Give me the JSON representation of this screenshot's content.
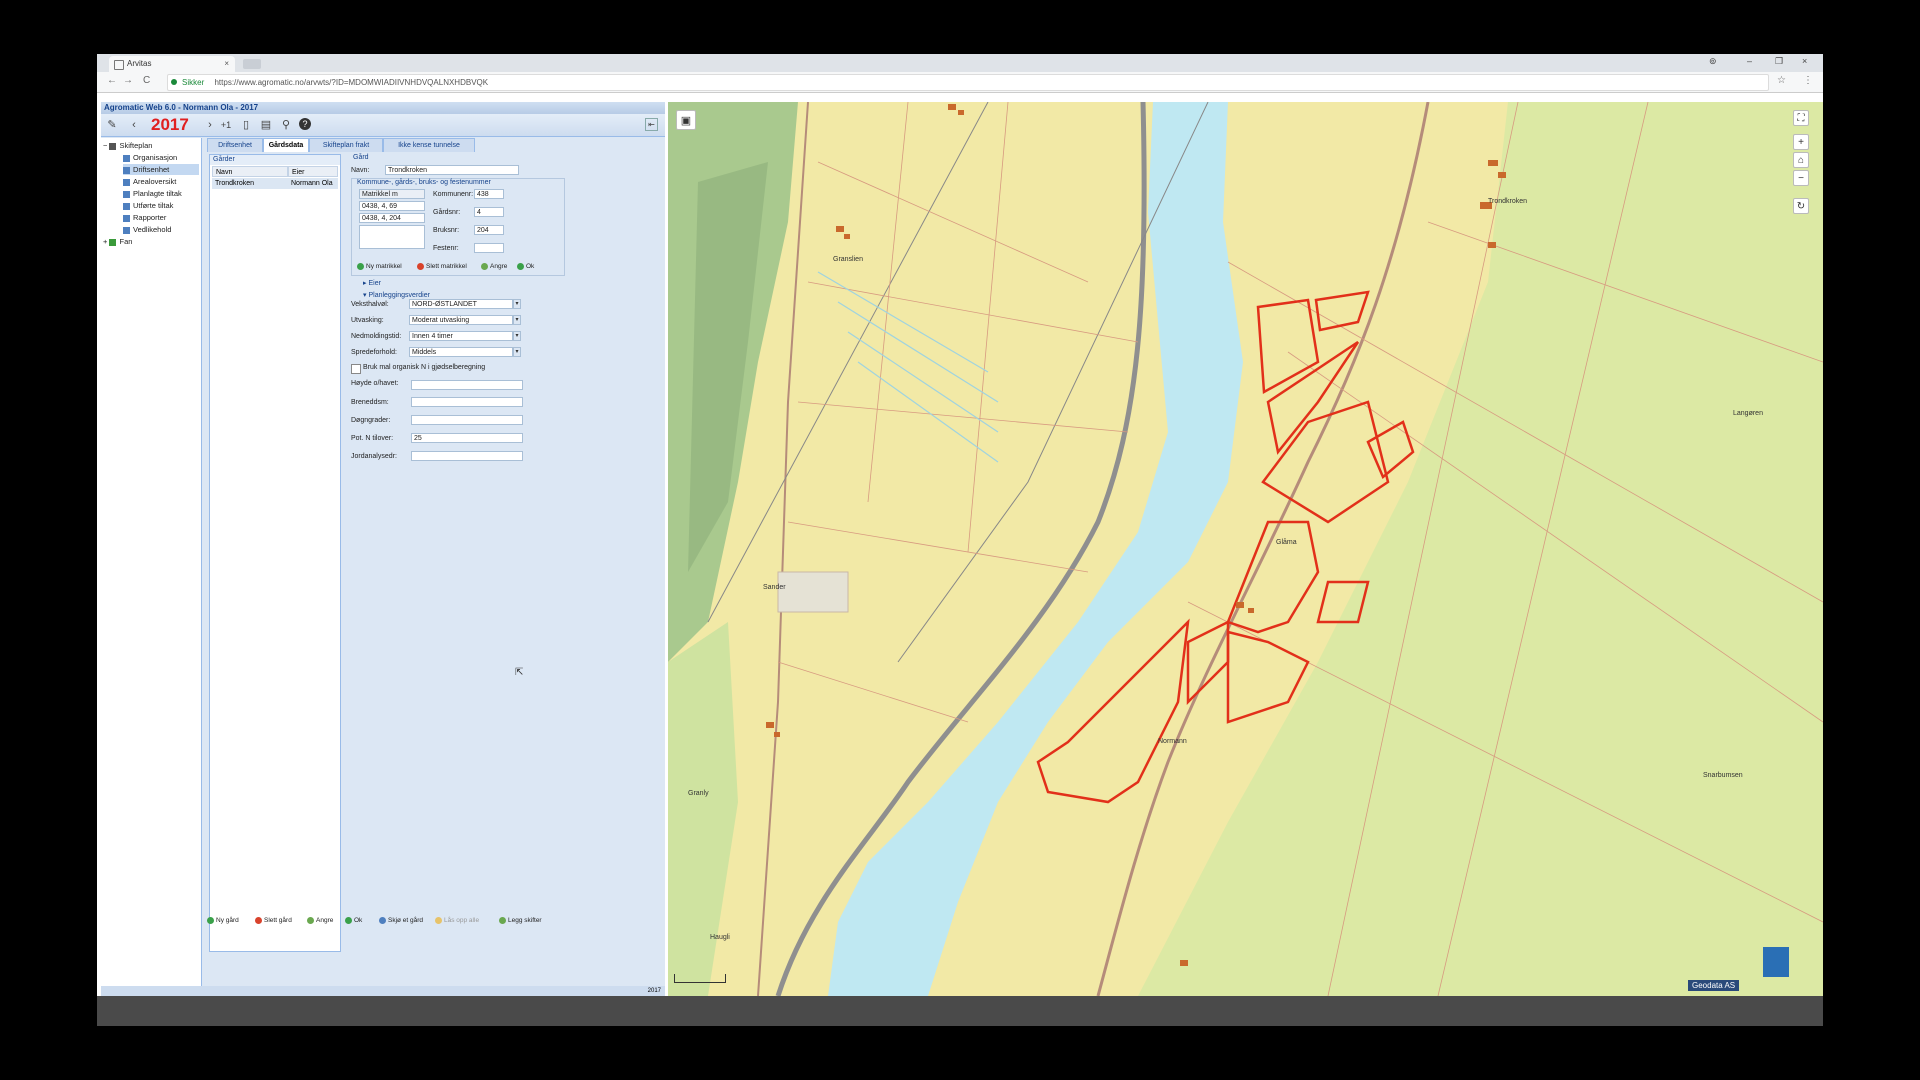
{
  "browser": {
    "tab_title": "Arvitas",
    "tab_close": "×",
    "window_controls": [
      "⊚",
      "–",
      "❐",
      "×"
    ],
    "nav": [
      "←",
      "→",
      "C"
    ],
    "secure_label": "Sikker",
    "url": "https://www.agromatic.no/arvwts/?ID=MDOMWIADIIVNHDVQALNXHDBVQK",
    "menu_icon": "⋮",
    "star_icon": "☆"
  },
  "app": {
    "title": "Agromatic Web 6.0 - Normann Ola - 2017",
    "year": "2017",
    "year_offset": "+1",
    "toolbar_icons": [
      "pencil-icon",
      "prev-icon",
      "next-icon",
      "phone-icon",
      "message-icon",
      "org-icon",
      "help-icon"
    ],
    "tree": [
      {
        "label": "Skifteplan",
        "level": 0,
        "expander": "−"
      },
      {
        "label": "Organisasjon",
        "level": 1
      },
      {
        "label": "Driftsenhet",
        "level": 1,
        "selected": true
      },
      {
        "label": "Arealoversikt",
        "level": 1
      },
      {
        "label": "Planlagte tiltak",
        "level": 1
      },
      {
        "label": "Utførte tiltak",
        "level": 1
      },
      {
        "label": "Rapporter",
        "level": 1
      },
      {
        "label": "Vedlikehold",
        "level": 1
      },
      {
        "label": "Fan",
        "level": 0,
        "expander": "+"
      }
    ],
    "tabs": [
      "Driftsenhet",
      "Gårdsdata",
      "Skifteplan frakt",
      "Ikke kense tunnelse"
    ],
    "grid": {
      "title": "Gårder",
      "columns": [
        "Navn",
        "Eier"
      ],
      "rows": [
        [
          "Trondkroken",
          "Normann Ola"
        ]
      ]
    },
    "form": {
      "section_title": "Gård",
      "name_label": "Navn:",
      "name_value": "Trondkroken",
      "matrikkel_section": "Kommune-, gårds-, bruks- og festenummer",
      "matrikkel_header": "Matrikkel m",
      "matrikkel_rows": [
        "0438, 4, 69",
        "0438, 4, 204"
      ],
      "kommune_label": "Kommunenr:",
      "kommune_value": "438",
      "gardsnr_label": "Gårdsnr:",
      "gardsnr_value": "4",
      "bruksnr_label": "Bruksnr:",
      "bruksnr_value": "204",
      "festenr_label": "Festenr:",
      "festenr_value": "",
      "matrikkel_buttons": [
        "Ny matrikkel",
        "Slett matrikkel",
        "Angre",
        "Ok"
      ],
      "eier_section": "Eier",
      "planlegging_section": "Planleggingsverdier",
      "fields_select": [
        {
          "label": "Veksthalvøl:",
          "value": "NORD-ØSTLANDET"
        },
        {
          "label": "Utvasking:",
          "value": "Moderat utvasking"
        },
        {
          "label": "Nedmoldingstid:",
          "value": "Innen 4 timer"
        },
        {
          "label": "Spredeforhold:",
          "value": "Middels"
        }
      ],
      "checkbox_label": "Bruk mal organisk N i gjødselberegning",
      "fields_text": [
        {
          "label": "Høyde o/havet:",
          "value": ""
        },
        {
          "label": "Breneddsm:",
          "value": ""
        },
        {
          "label": "Døgngrader:",
          "value": ""
        },
        {
          "label": "Pot. N tilover:",
          "value": "25"
        },
        {
          "label": "Jordanalysedr:",
          "value": ""
        }
      ]
    },
    "bottom_buttons": [
      "Ny gård",
      "Slett gård",
      "Angre",
      "Ok",
      "Skjø et gård",
      "Lås opp alle",
      "Legg skifter"
    ],
    "status_text": "2017"
  },
  "map": {
    "labels": [
      "Trondkroken",
      "Granslien",
      "Langøren",
      "Glåma",
      "Normann",
      "Granly",
      "Sander",
      "Snarbumsen",
      "Haugli"
    ],
    "attribution": "Geodata AS",
    "colors": {
      "farmland": "#f2e9a6",
      "river": "#bfe8f2",
      "forest": "#dce9a4",
      "parcel": "#e2301a",
      "road": "#b58c7a"
    }
  }
}
